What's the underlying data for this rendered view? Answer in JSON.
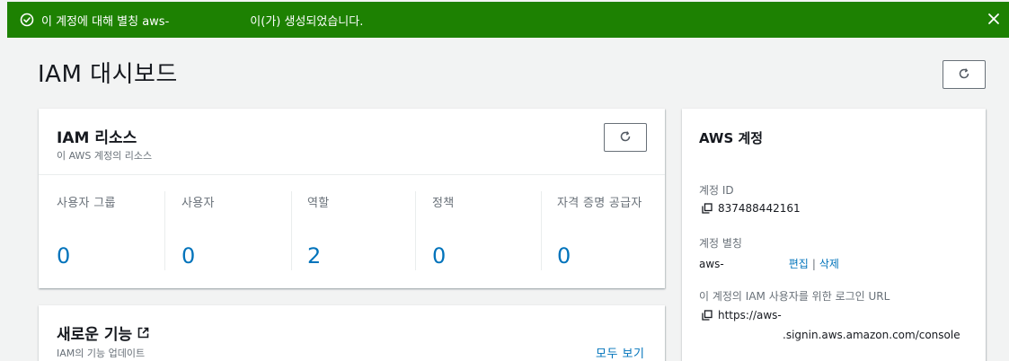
{
  "banner": {
    "message_prefix": "이 계정에 대해 별칭 aws-",
    "message_suffix": "이(가) 생성되었습니다.",
    "color": "#1d8102"
  },
  "page": {
    "title": "IAM 대시보드"
  },
  "resources": {
    "title": "IAM 리소스",
    "subtitle": "이 AWS 계정의 리소스",
    "metrics": [
      {
        "label": "사용자 그룹",
        "value": "0"
      },
      {
        "label": "사용자",
        "value": "0"
      },
      {
        "label": "역할",
        "value": "2"
      },
      {
        "label": "정책",
        "value": "0"
      },
      {
        "label": "자격 증명 공급자",
        "value": "0"
      }
    ]
  },
  "whats_new": {
    "title": "새로운 기능",
    "subtitle": "IAM의 기능 업데이트",
    "view_all": "모두 보기"
  },
  "account": {
    "title": "AWS 계정",
    "id_label": "계정 ID",
    "id_value": "837488442161",
    "alias_label": "계정 별칭",
    "alias_value": "aws-",
    "edit_label": "편집",
    "delete_label": "삭제",
    "signin_label": "이 계정의 IAM 사용자를 위한 로그인 URL",
    "signin_url_line1": "https://aws-",
    "signin_url_line2": ".signin.aws.amazon.com/console"
  },
  "colors": {
    "link": "#0073bb",
    "success": "#1d8102",
    "muted": "#687078"
  },
  "icons": [
    "check-circle-icon",
    "close-icon",
    "refresh-icon",
    "external-link-icon",
    "copy-icon"
  ]
}
